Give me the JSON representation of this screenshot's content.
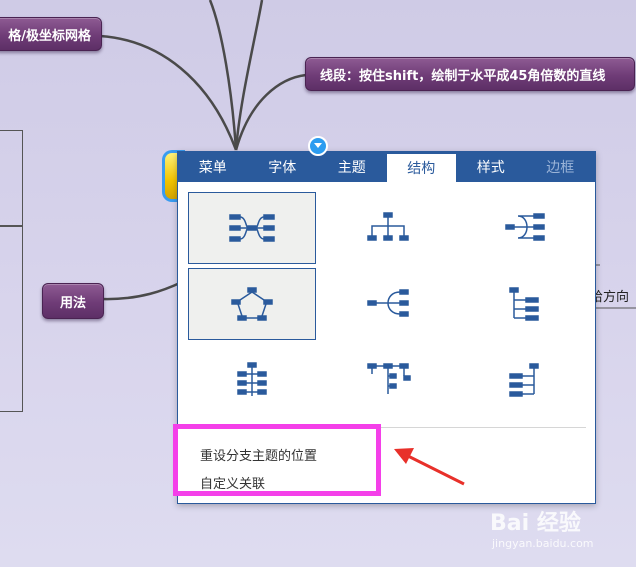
{
  "map": {
    "topics": {
      "grid_fragment": "格/极坐标网格",
      "line_segment": "线段：按住shift，绘制于水平成45角倍数的直线",
      "usage": "用法"
    },
    "side_fragment": "给方向"
  },
  "panel": {
    "tabs": [
      {
        "label": "菜单",
        "state": "normal"
      },
      {
        "label": "字体",
        "state": "normal"
      },
      {
        "label": "主题",
        "state": "normal"
      },
      {
        "label": "结构",
        "state": "active"
      },
      {
        "label": "样式",
        "state": "normal"
      },
      {
        "label": "边框",
        "state": "disabled"
      }
    ],
    "structures": [
      {
        "icon": "mind-map-icon",
        "selected": true
      },
      {
        "icon": "org-chart-down-icon",
        "selected": false
      },
      {
        "icon": "right-bracket-tree-icon",
        "selected": false
      },
      {
        "icon": "radial-map-icon",
        "selected": true
      },
      {
        "icon": "left-bracket-tree-icon",
        "selected": false
      },
      {
        "icon": "right-tree-list-icon",
        "selected": false
      },
      {
        "icon": "vertical-timeline-icon",
        "selected": false
      },
      {
        "icon": "fishbone-down-icon",
        "selected": false
      },
      {
        "icon": "left-tree-list-icon",
        "selected": false
      }
    ],
    "menu_items": {
      "reset_positions": "重设分支主题的位置",
      "custom_relation": "自定义关联"
    }
  },
  "watermark": {
    "main": "Bai 经验",
    "sub": "jingyan.baidu.com"
  },
  "colors": {
    "tab_bar": "#2a5a9c",
    "highlight": "#f43fe9",
    "arrow": "#e8302a",
    "topic": "#6f3c77"
  }
}
